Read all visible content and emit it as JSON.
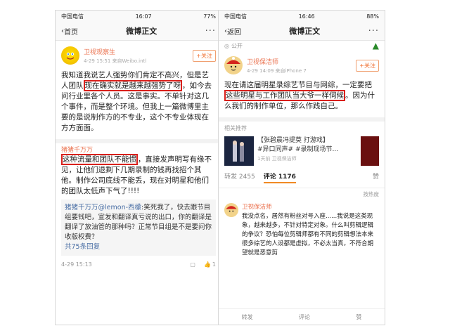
{
  "left": {
    "status": {
      "carrier": "中国电信",
      "time": "16:07",
      "battery": "77%"
    },
    "nav": {
      "back": "首页",
      "title": "微博正文",
      "more": "···"
    },
    "author": {
      "name": "卫视观察生",
      "time": "4-29 15:51",
      "source": "来自Weibo.intl",
      "follow": "+关注"
    },
    "post": {
      "p1": "我知道我说艺人强势你们肯定不高兴，但是艺人团队",
      "p1_hl": "现在确实就是越来越强势了呀",
      "p1b": "，如今去问行业里各个人员。这是事实。不单针对这几个事件，而是整个环境。但我上一篇微博里主要的是说制作方的不专业，这个不专业体现在方方面面。"
    },
    "repost": {
      "user": "猪猪千万万",
      "hl": "这种流量和团队不能惯",
      "text": "，直接发声明写有缘不见，让他们退剩下几期录制的钱再找招个其他。制作公司底线不能丢，现在对明星和他们的团队太低声下气了!!!!"
    },
    "quote": {
      "user": "猪猪千万万",
      "mention": "@lemon-西檬",
      "text": ":笑死我了，快去跟节目组要钱吧，宣发和翻译真亏说的出口，你的翻译是翻译了放油管的那种吗？正常节目组是不是要问你收版权费？",
      "more": "共75条回复"
    },
    "footer": {
      "time": "4-29 15:13",
      "likes": "1"
    }
  },
  "right": {
    "status": {
      "carrier": "中国电信",
      "time": "16:46",
      "battery": "88%"
    },
    "nav": {
      "back": "返回",
      "title": "微博正文",
      "more": "···"
    },
    "pub": "公开",
    "author": {
      "name": "卫视保洁师",
      "time": "4-29 14:09",
      "source": "来自iPhone 7",
      "follow": "+关注"
    },
    "post": {
      "p1": "现在请这届明星录综艺节目与网综，一定要把",
      "p1_hl": "这些明星与工作团队当大爷一样伺候",
      "p1b": "。因为什么我们的制作单位，那么作践自己。"
    },
    "related": {
      "label": "相关推荐",
      "title": "【张碧晨冯提莫 打游戏】",
      "tags": "#异口同声# #录制现场节...",
      "sub": "1天前  卫视保洁师"
    },
    "tabs": {
      "repost": "转发 2455",
      "comment": "评论 1176",
      "like": "赞"
    },
    "sort": "按热度",
    "comment": {
      "name": "卫视保洁师",
      "text": "我没点名，居然有粉丝对号入座......我说是这类现象，越来越多，不针对特定对象。什么叫剪辑逻辑的争议？恐怕每位剪辑师都有不同的剪辑想法本来很多综艺的人设都是虚拟，不必太当真，不符合期望就是恶意剪"
    },
    "bottom": {
      "repost": "转发",
      "comment": "评论",
      "like": "赞"
    }
  }
}
